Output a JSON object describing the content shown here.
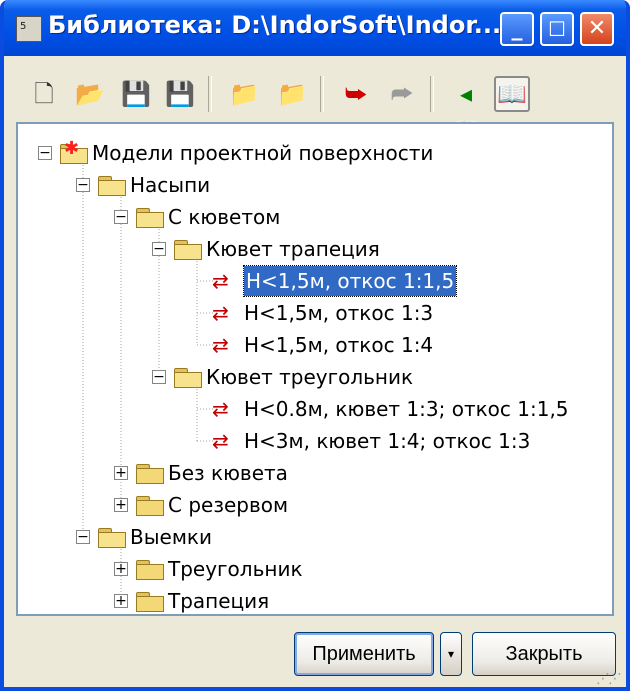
{
  "window": {
    "title": "Библиотека: D:\\IndorSoft\\Indor...",
    "app_icon_text": "5"
  },
  "titlebar_buttons": {
    "minimize": "_",
    "maximize": "☐",
    "close": "✕"
  },
  "toolbar": [
    {
      "id": "new-library",
      "glyph": "🗋",
      "color": "#333"
    },
    {
      "id": "open-library",
      "glyph": "📂",
      "color": "#b88a00"
    },
    {
      "id": "save",
      "glyph": "💾",
      "color": "#111"
    },
    {
      "id": "save-as",
      "glyph": "💾",
      "color": "#444"
    },
    {
      "id": "new-folder",
      "glyph": "📁",
      "color": "#c9a100"
    },
    {
      "id": "delete-folder",
      "glyph": "📁",
      "color": "#b06000"
    },
    {
      "id": "import",
      "glyph": "⮩",
      "color": "#d00000"
    },
    {
      "id": "export",
      "glyph": "⮫",
      "color": "#9a9a9a"
    },
    {
      "id": "collapse-back",
      "glyph": "◂📖",
      "color": "#008000"
    },
    {
      "id": "expand-forward",
      "glyph": "📖▸",
      "color": "#008000",
      "pressed": true
    }
  ],
  "tree": [
    {
      "label": "Модели проектной поверхности",
      "level": 0,
      "type": "root",
      "expander": "−"
    },
    {
      "label": "Насыпи",
      "level": 1,
      "type": "folder-open",
      "expander": "−"
    },
    {
      "label": "С кюветом",
      "level": 2,
      "type": "folder-open",
      "expander": "−"
    },
    {
      "label": "Кювет трапеция",
      "level": 3,
      "type": "folder-open",
      "expander": "−"
    },
    {
      "label": "H<1,5м,  откос 1:1,5",
      "level": 4,
      "type": "model",
      "selected": true
    },
    {
      "label": "H<1,5м,  откос 1:3",
      "level": 4,
      "type": "model"
    },
    {
      "label": "H<1,5м,  откос 1:4",
      "level": 4,
      "type": "model"
    },
    {
      "label": "Кювет треугольник",
      "level": 3,
      "type": "folder-open",
      "expander": "−"
    },
    {
      "label": "H<0.8м,  кювет 1:3; откос 1:1,5",
      "level": 4,
      "type": "model"
    },
    {
      "label": "H<3м,  кювет 1:4; откос 1:3",
      "level": 4,
      "type": "model"
    },
    {
      "label": "Без кювета",
      "level": 2,
      "type": "folder",
      "expander": "+"
    },
    {
      "label": "С резервом",
      "level": 2,
      "type": "folder",
      "expander": "+"
    },
    {
      "label": "Выемки",
      "level": 1,
      "type": "folder-open",
      "expander": "−"
    },
    {
      "label": "Треугольник",
      "level": 2,
      "type": "folder",
      "expander": "+"
    },
    {
      "label": "Трапеция",
      "level": 2,
      "type": "folder",
      "expander": "+"
    }
  ],
  "buttons": {
    "apply": "Применить",
    "apply_dropdown": "▾",
    "close": "Закрыть"
  }
}
